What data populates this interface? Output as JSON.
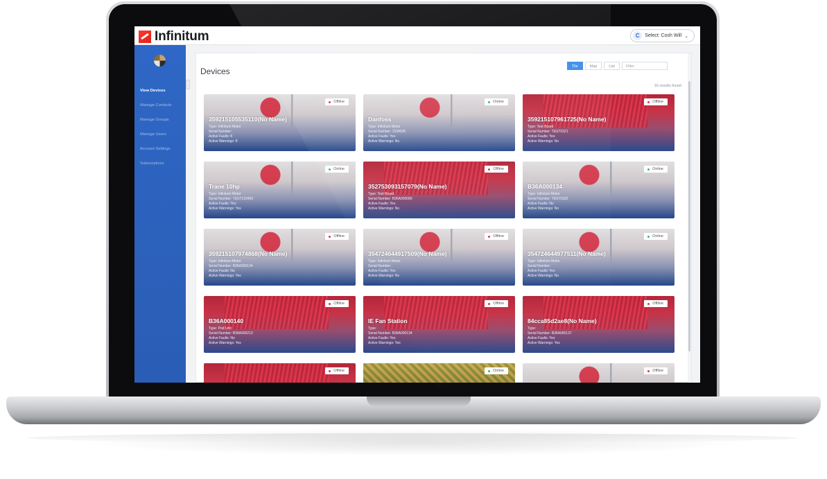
{
  "app": {
    "logo_text": "Infinitum",
    "user_initial": "C",
    "user_label": "Select: Cosh Will",
    "user_caret": "⌄"
  },
  "sidebar": {
    "items": [
      {
        "label": "View Devices",
        "active": true
      },
      {
        "label": "Manage Contacts",
        "active": false
      },
      {
        "label": "Manage Groups",
        "active": false
      },
      {
        "label": "Manage Users",
        "active": false
      },
      {
        "label": "Account Settings",
        "active": false
      },
      {
        "label": "Subscriptions",
        "active": false
      }
    ]
  },
  "main": {
    "title": "Devices",
    "view_toggles": [
      "Tile",
      "Map",
      "List"
    ],
    "active_toggle": "Tile",
    "filter_placeholder": "Filter",
    "results": "16 results found"
  },
  "colors": {
    "online": "#33b86a",
    "offline": "#e5323b",
    "sidebar": "#2f67c6",
    "accent": "#3c8ce7"
  },
  "devices": [
    {
      "name": "359215105535110(No Name)",
      "type": "Type: Infinitum Motor",
      "serial": "Serial Number:",
      "faults": "Active Faults: 8",
      "warnings": "Active Warnings: 8",
      "status": "Offline",
      "art": "motor"
    },
    {
      "name": "Danfoss",
      "type": "Type: Infinitum Motor",
      "serial": "Serial Number: 1234536",
      "faults": "Active Faults: Yes",
      "warnings": "Active Warnings: No",
      "status": "Online",
      "art": "motor"
    },
    {
      "name": "359215107961725(No Name)",
      "type": "Type: Test Board",
      "serial": "Serial Number: TEST0321",
      "faults": "Active Faults: Yes",
      "warnings": "Active Warnings: No",
      "status": "Offline",
      "art": "fan"
    },
    {
      "name": "Trane 10hp",
      "type": "Type: Infinitum Motor",
      "serial": "Serial Number: TEST123456",
      "faults": "Active Faults: Yes",
      "warnings": "Active Warnings: Yes",
      "status": "Online",
      "art": "motor"
    },
    {
      "name": "352753093157079(No Name)",
      "type": "Type: Test Board",
      "serial": "Serial Number: B36A000080",
      "faults": "Active Faults: Yes",
      "warnings": "Active Warnings: No",
      "status": "Offline",
      "art": "fan"
    },
    {
      "name": "B36A000134",
      "type": "Type: Infinitum Motor",
      "serial": "Serial Number: TEST0322",
      "faults": "Active Faults: No",
      "warnings": "Active Warnings: No",
      "status": "Online",
      "art": "motor"
    },
    {
      "name": "359215107974868(No Name)",
      "type": "Type: Infinitum Motor",
      "serial": "Serial Number: B36A000134",
      "faults": "Active Faults: No",
      "warnings": "Active Warnings: Yes",
      "status": "Offline",
      "art": "motor"
    },
    {
      "name": "354724644917509(No Name)",
      "type": "Type: Infinitum Motor",
      "serial": "Serial Number:",
      "faults": "Active Faults: Yes",
      "warnings": "Active Warnings: No",
      "status": "Offline",
      "art": "motor"
    },
    {
      "name": "354724644977511(No Name)",
      "type": "Type: Infinitum Motor",
      "serial": "Serial Number:",
      "faults": "Active Faults: Yes",
      "warnings": "Active Warnings: No",
      "status": "Online",
      "art": "motor"
    },
    {
      "name": "B36A000140",
      "type": "Type: Pod Unit",
      "serial": "Serial Number: B36A000213",
      "faults": "Active Faults: No",
      "warnings": "Active Warnings: Yes",
      "status": "Offline",
      "art": "fan"
    },
    {
      "name": "IE Fan Station",
      "type": "Type:",
      "serial": "Serial Number: B36A000134",
      "faults": "Active Faults: Yes",
      "warnings": "Active Warnings: Yes",
      "status": "Offline",
      "art": "fan"
    },
    {
      "name": "84cca85d2ae8(No Name)",
      "type": "Type:",
      "serial": "Serial Number: B36A000137",
      "faults": "Active Faults: Yes",
      "warnings": "Active Warnings: Yes",
      "status": "Offline",
      "art": "fan"
    },
    {
      "name": "",
      "type": "",
      "serial": "",
      "faults": "",
      "warnings": "",
      "status": "Offline",
      "art": "fan"
    },
    {
      "name": "",
      "type": "",
      "serial": "",
      "faults": "",
      "warnings": "",
      "status": "Online",
      "art": "photo"
    },
    {
      "name": "",
      "type": "",
      "serial": "",
      "faults": "",
      "warnings": "",
      "status": "Offline",
      "art": "motor"
    }
  ]
}
